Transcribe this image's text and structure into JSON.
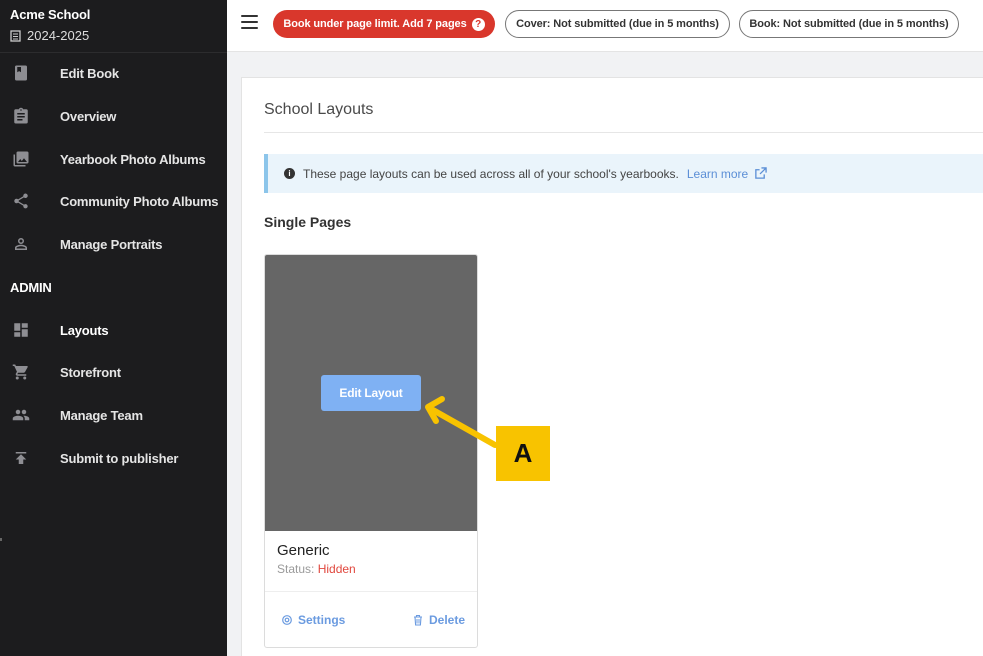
{
  "brand": {
    "name": "Acme School",
    "year": "2024-2025"
  },
  "sidebar": {
    "items": [
      {
        "label": "Edit Book",
        "icon": "book-icon"
      },
      {
        "label": "Overview",
        "icon": "clipboard-icon"
      },
      {
        "label": "Yearbook Photo Albums",
        "icon": "photo-albums-icon"
      },
      {
        "label": "Community Photo Albums",
        "icon": "share-icon"
      },
      {
        "label": "Manage Portraits",
        "icon": "person-icon"
      }
    ],
    "admin_label": "ADMIN",
    "admin_items": [
      {
        "label": "Layouts",
        "icon": "dashboard-icon",
        "active": true
      },
      {
        "label": "Storefront",
        "icon": "cart-icon"
      },
      {
        "label": "Manage Team",
        "icon": "people-icon"
      },
      {
        "label": "Submit to publisher",
        "icon": "upload-icon"
      }
    ]
  },
  "topbar": {
    "alert_pill": "Book under page limit. Add 7 pages",
    "alert_help": "?",
    "cover_pill": "Cover: Not submitted (due in 5 months)",
    "book_pill": "Book: Not submitted (due in 5 months)"
  },
  "main": {
    "title": "School Layouts",
    "info_text": "These page layouts can be used across all of your school's yearbooks.",
    "learn_more": "Learn more",
    "section_title": "Single Pages",
    "layout_card": {
      "edit_button": "Edit Layout",
      "name": "Generic",
      "status_label": "Status:",
      "status_value": "Hidden",
      "settings": "Settings",
      "delete": "Delete"
    }
  },
  "annotation": {
    "label": "A",
    "color": "#f8c300"
  },
  "colors": {
    "sidebar_bg": "#1c1c1e",
    "alert_red": "#d9372c",
    "accent_blue": "#6b9be0",
    "edit_button": "#7fb1f3"
  }
}
